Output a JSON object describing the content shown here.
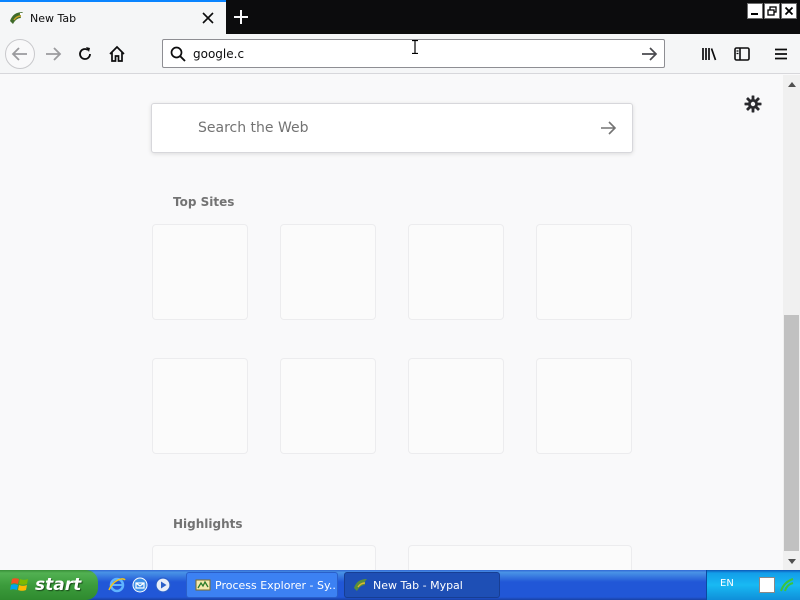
{
  "tab": {
    "title": "New Tab"
  },
  "navbar": {
    "url_value": "google.c"
  },
  "newtab_page": {
    "search_placeholder": "Search the Web",
    "top_sites_title": "Top Sites",
    "highlights_title": "Highlights"
  },
  "icons": {
    "back": "back-arrow-icon",
    "forward": "forward-arrow-icon",
    "reload": "reload-icon",
    "home": "home-icon",
    "library": "library-icon",
    "sidebar": "sidebar-icon",
    "menu": "hamburger-menu-icon",
    "settings": "gear-icon"
  },
  "taskbar": {
    "start_label": "start",
    "items": [
      {
        "label": "Process Explorer - Sy..."
      },
      {
        "label": "New Tab - Mypal"
      }
    ],
    "language": "EN"
  },
  "colors": {
    "accent": "#0a84ff",
    "taskbar_blue": "#2157d7",
    "start_green": "#3c9c3c"
  }
}
